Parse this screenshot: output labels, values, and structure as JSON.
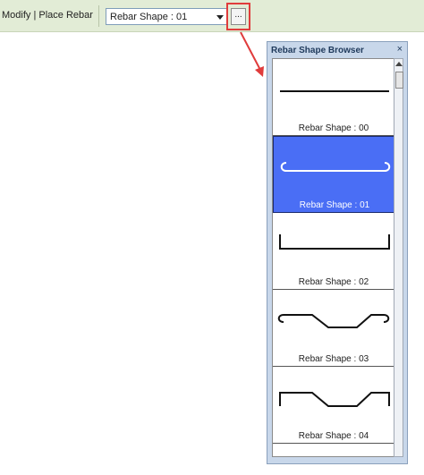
{
  "options_bar": {
    "context_label": "Modify | Place Rebar",
    "shape_select_value": "Rebar Shape : 01",
    "browse_button_label": "..."
  },
  "highlight_color": "#e03c3c",
  "selection_color": "#4a6ef5",
  "browser": {
    "title": "Rebar Shape Browser",
    "close_label": "×",
    "items": [
      {
        "label": "Rebar Shape : 00",
        "selected": false
      },
      {
        "label": "Rebar Shape : 01",
        "selected": true
      },
      {
        "label": "Rebar Shape : 02",
        "selected": false
      },
      {
        "label": "Rebar Shape : 03",
        "selected": false
      },
      {
        "label": "Rebar Shape : 04",
        "selected": false
      }
    ]
  }
}
